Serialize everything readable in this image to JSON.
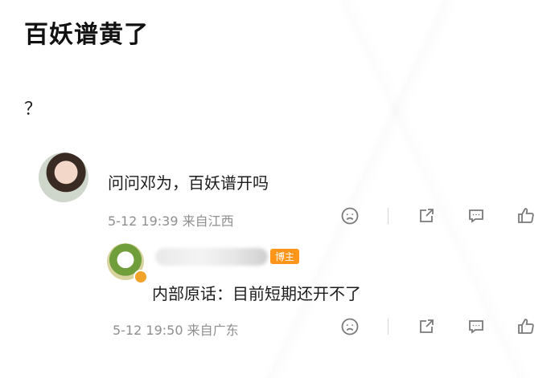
{
  "post": {
    "title": "百妖谱黄了",
    "body": "？"
  },
  "comment": {
    "text": "问问邓为，百妖谱开吗",
    "time": "5-12 19:39",
    "location": "来自江西",
    "avatar": "avatar-woman"
  },
  "reply": {
    "badge": "博主",
    "text": "内部原话：目前短期还开不了",
    "time": "5-12 19:50",
    "location": "来自广东",
    "avatar": "avatar-cartoon-leaf"
  },
  "icons": [
    "dislike-face-icon",
    "share-icon",
    "comment-icon",
    "like-icon"
  ],
  "colors": {
    "text": "#1c1c1c",
    "meta": "#8f8f8f",
    "badge": "#ff8a00"
  }
}
